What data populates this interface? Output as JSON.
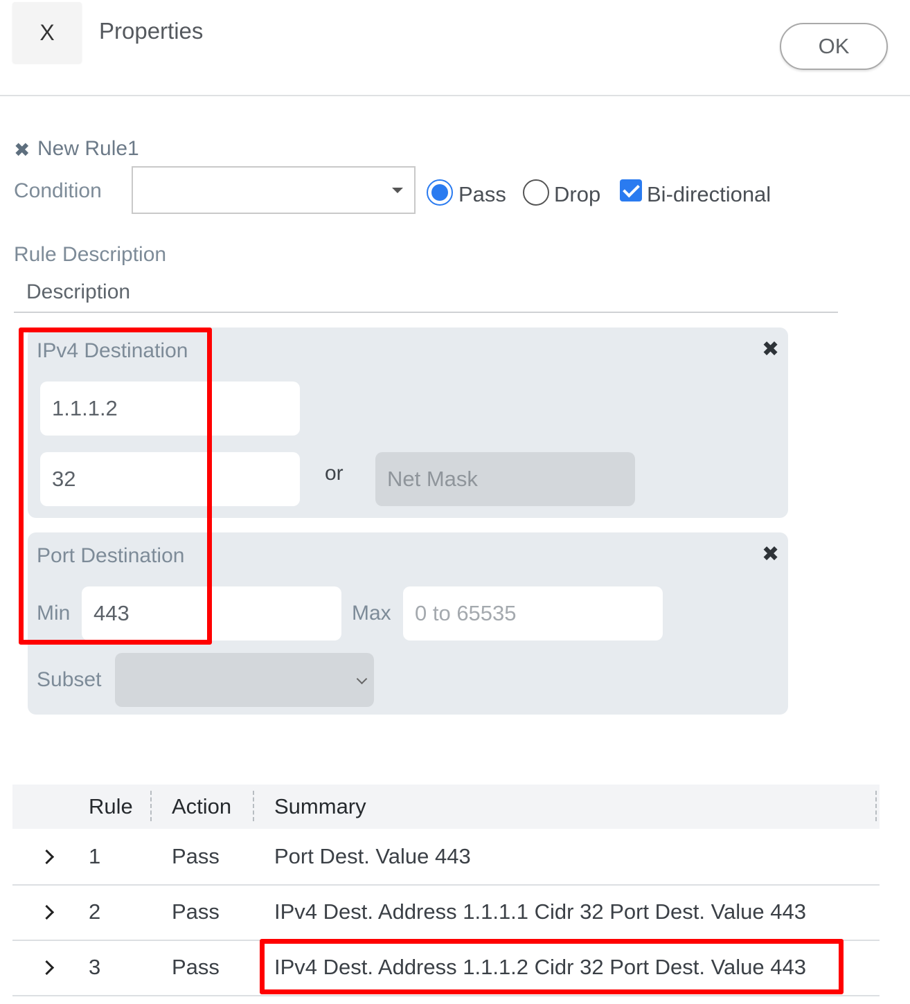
{
  "header": {
    "close_label": "X",
    "title": "Properties",
    "ok_label": "OK"
  },
  "rule": {
    "remove_icon": "✖",
    "name": "New Rule1",
    "condition_label": "Condition",
    "condition_value": "",
    "options": {
      "pass_label": "Pass",
      "drop_label": "Drop",
      "bidirectional_label": "Bi-directional",
      "selected": "Pass",
      "bidirectional_checked": true
    },
    "description_label": "Rule Description",
    "description_placeholder": "Description"
  },
  "ipv4_panel": {
    "title": "IPv4 Destination",
    "address": "1.1.1.2",
    "cidr": "32",
    "or_label": "or",
    "netmask_placeholder": "Net Mask",
    "remove_icon": "✖"
  },
  "port_panel": {
    "title": "Port Destination",
    "min_label": "Min",
    "min_value": "443",
    "max_label": "Max",
    "max_placeholder": "0 to 65535",
    "subset_label": "Subset",
    "subset_value": "",
    "remove_icon": "✖"
  },
  "table": {
    "columns": [
      "Rule",
      "Action",
      "Summary"
    ],
    "rows": [
      {
        "rule": "1",
        "action": "Pass",
        "summary": "Port Dest. Value 443"
      },
      {
        "rule": "2",
        "action": "Pass",
        "summary": "IPv4 Dest. Address 1.1.1.1 Cidr 32 Port Dest. Value 443"
      },
      {
        "rule": "3",
        "action": "Pass",
        "summary": "IPv4 Dest. Address 1.1.1.2 Cidr 32 Port Dest. Value 443"
      }
    ]
  },
  "colors": {
    "accent": "#2a7bf0",
    "highlight": "#ff0000",
    "panel_bg": "#e7ebef"
  }
}
